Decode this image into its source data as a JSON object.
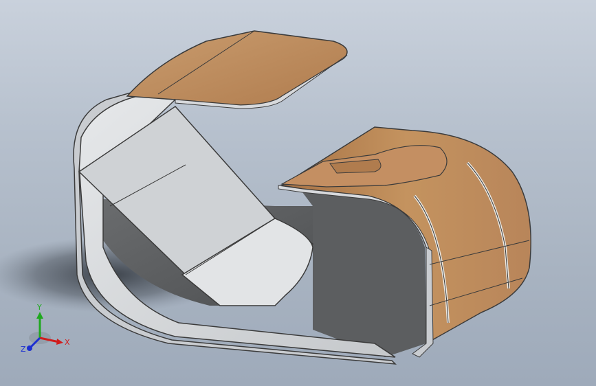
{
  "viewport": {
    "background_top": "#c9d1dc",
    "background_bottom": "#9eaaba"
  },
  "model": {
    "panel_color": "#b98a5e",
    "panel_color_light": "#c8976a",
    "inner_light": "#d4d6d8",
    "inner_dark": "#5a5c5e",
    "edge_color": "#3b3b3b"
  },
  "triad": {
    "x_label": "X",
    "y_label": "Y",
    "z_label": "Z",
    "x_color": "#d11c1c",
    "y_color": "#1fa81f",
    "z_color": "#1c2fd1"
  }
}
